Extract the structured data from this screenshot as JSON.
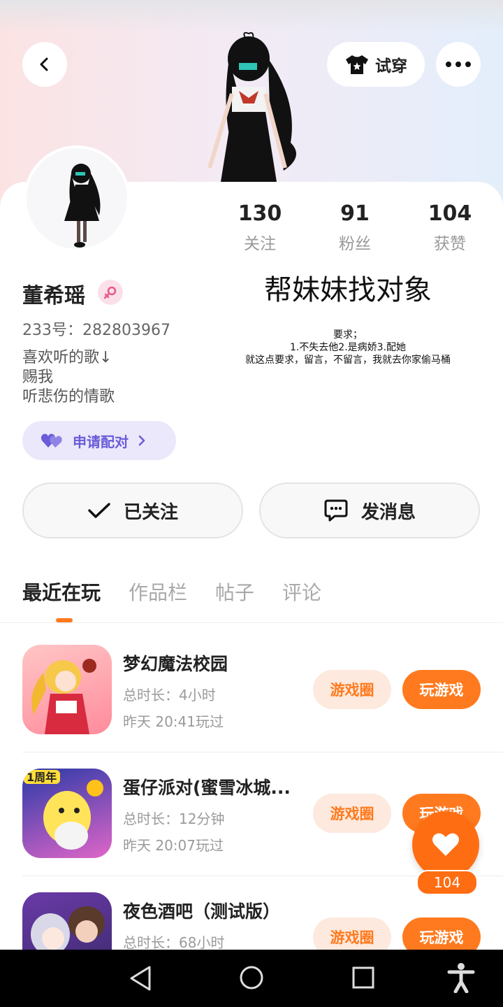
{
  "header": {
    "tryon_label": "试穿"
  },
  "stats": [
    {
      "value": "130",
      "label": "关注"
    },
    {
      "value": "91",
      "label": "粉丝"
    },
    {
      "value": "104",
      "label": "获赞"
    }
  ],
  "profile": {
    "name": "董希瑶",
    "uid": "233号：282803967",
    "bio": "喜欢听的歌↓\n赐我\n听悲伤的情歌",
    "headline": "帮妹妹找对象",
    "requirements": "要求；\n1.不失去他2.是病娇3.配她\n就这点要求，留言，不留言，我就去你家偷马桶",
    "pair_label": "申请配对"
  },
  "actions": {
    "follow_label": "已关注",
    "message_label": "发消息"
  },
  "tabs": [
    "最近在玩",
    "作品栏",
    "帖子",
    "评论"
  ],
  "games": [
    {
      "title": "梦幻魔法校园",
      "duration": "总时长：4小时",
      "last_played": "昨天 20:41玩过",
      "circle_label": "游戏圈",
      "play_label": "玩游戏"
    },
    {
      "title": "蛋仔派对(蜜雪冰城...",
      "duration": "总时长：12分钟",
      "last_played": "昨天 20:07玩过",
      "circle_label": "游戏圈",
      "play_label": "玩游戏",
      "badge": "1周年"
    },
    {
      "title": "夜色酒吧（测试版）",
      "duration": "总时长：68小时",
      "last_played": "",
      "circle_label": "游戏圈",
      "play_label": "玩游戏"
    }
  ],
  "fab": {
    "count": "104"
  },
  "colors": {
    "accent": "#ff7a1e",
    "pair": "#6a5cd8",
    "pair_bg": "#ebe8fb"
  }
}
